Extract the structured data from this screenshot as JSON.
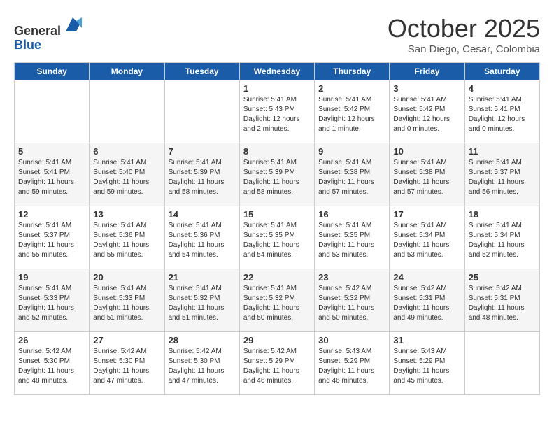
{
  "header": {
    "logo_line1": "General",
    "logo_line2": "Blue",
    "month": "October 2025",
    "location": "San Diego, Cesar, Colombia"
  },
  "days_of_week": [
    "Sunday",
    "Monday",
    "Tuesday",
    "Wednesday",
    "Thursday",
    "Friday",
    "Saturday"
  ],
  "weeks": [
    [
      {
        "day": "",
        "info": ""
      },
      {
        "day": "",
        "info": ""
      },
      {
        "day": "",
        "info": ""
      },
      {
        "day": "1",
        "info": "Sunrise: 5:41 AM\nSunset: 5:43 PM\nDaylight: 12 hours\nand 2 minutes."
      },
      {
        "day": "2",
        "info": "Sunrise: 5:41 AM\nSunset: 5:42 PM\nDaylight: 12 hours\nand 1 minute."
      },
      {
        "day": "3",
        "info": "Sunrise: 5:41 AM\nSunset: 5:42 PM\nDaylight: 12 hours\nand 0 minutes."
      },
      {
        "day": "4",
        "info": "Sunrise: 5:41 AM\nSunset: 5:41 PM\nDaylight: 12 hours\nand 0 minutes."
      }
    ],
    [
      {
        "day": "5",
        "info": "Sunrise: 5:41 AM\nSunset: 5:41 PM\nDaylight: 11 hours\nand 59 minutes."
      },
      {
        "day": "6",
        "info": "Sunrise: 5:41 AM\nSunset: 5:40 PM\nDaylight: 11 hours\nand 59 minutes."
      },
      {
        "day": "7",
        "info": "Sunrise: 5:41 AM\nSunset: 5:39 PM\nDaylight: 11 hours\nand 58 minutes."
      },
      {
        "day": "8",
        "info": "Sunrise: 5:41 AM\nSunset: 5:39 PM\nDaylight: 11 hours\nand 58 minutes."
      },
      {
        "day": "9",
        "info": "Sunrise: 5:41 AM\nSunset: 5:38 PM\nDaylight: 11 hours\nand 57 minutes."
      },
      {
        "day": "10",
        "info": "Sunrise: 5:41 AM\nSunset: 5:38 PM\nDaylight: 11 hours\nand 57 minutes."
      },
      {
        "day": "11",
        "info": "Sunrise: 5:41 AM\nSunset: 5:37 PM\nDaylight: 11 hours\nand 56 minutes."
      }
    ],
    [
      {
        "day": "12",
        "info": "Sunrise: 5:41 AM\nSunset: 5:37 PM\nDaylight: 11 hours\nand 55 minutes."
      },
      {
        "day": "13",
        "info": "Sunrise: 5:41 AM\nSunset: 5:36 PM\nDaylight: 11 hours\nand 55 minutes."
      },
      {
        "day": "14",
        "info": "Sunrise: 5:41 AM\nSunset: 5:36 PM\nDaylight: 11 hours\nand 54 minutes."
      },
      {
        "day": "15",
        "info": "Sunrise: 5:41 AM\nSunset: 5:35 PM\nDaylight: 11 hours\nand 54 minutes."
      },
      {
        "day": "16",
        "info": "Sunrise: 5:41 AM\nSunset: 5:35 PM\nDaylight: 11 hours\nand 53 minutes."
      },
      {
        "day": "17",
        "info": "Sunrise: 5:41 AM\nSunset: 5:34 PM\nDaylight: 11 hours\nand 53 minutes."
      },
      {
        "day": "18",
        "info": "Sunrise: 5:41 AM\nSunset: 5:34 PM\nDaylight: 11 hours\nand 52 minutes."
      }
    ],
    [
      {
        "day": "19",
        "info": "Sunrise: 5:41 AM\nSunset: 5:33 PM\nDaylight: 11 hours\nand 52 minutes."
      },
      {
        "day": "20",
        "info": "Sunrise: 5:41 AM\nSunset: 5:33 PM\nDaylight: 11 hours\nand 51 minutes."
      },
      {
        "day": "21",
        "info": "Sunrise: 5:41 AM\nSunset: 5:32 PM\nDaylight: 11 hours\nand 51 minutes."
      },
      {
        "day": "22",
        "info": "Sunrise: 5:41 AM\nSunset: 5:32 PM\nDaylight: 11 hours\nand 50 minutes."
      },
      {
        "day": "23",
        "info": "Sunrise: 5:42 AM\nSunset: 5:32 PM\nDaylight: 11 hours\nand 50 minutes."
      },
      {
        "day": "24",
        "info": "Sunrise: 5:42 AM\nSunset: 5:31 PM\nDaylight: 11 hours\nand 49 minutes."
      },
      {
        "day": "25",
        "info": "Sunrise: 5:42 AM\nSunset: 5:31 PM\nDaylight: 11 hours\nand 48 minutes."
      }
    ],
    [
      {
        "day": "26",
        "info": "Sunrise: 5:42 AM\nSunset: 5:30 PM\nDaylight: 11 hours\nand 48 minutes."
      },
      {
        "day": "27",
        "info": "Sunrise: 5:42 AM\nSunset: 5:30 PM\nDaylight: 11 hours\nand 47 minutes."
      },
      {
        "day": "28",
        "info": "Sunrise: 5:42 AM\nSunset: 5:30 PM\nDaylight: 11 hours\nand 47 minutes."
      },
      {
        "day": "29",
        "info": "Sunrise: 5:42 AM\nSunset: 5:29 PM\nDaylight: 11 hours\nand 46 minutes."
      },
      {
        "day": "30",
        "info": "Sunrise: 5:43 AM\nSunset: 5:29 PM\nDaylight: 11 hours\nand 46 minutes."
      },
      {
        "day": "31",
        "info": "Sunrise: 5:43 AM\nSunset: 5:29 PM\nDaylight: 11 hours\nand 45 minutes."
      },
      {
        "day": "",
        "info": ""
      }
    ]
  ]
}
